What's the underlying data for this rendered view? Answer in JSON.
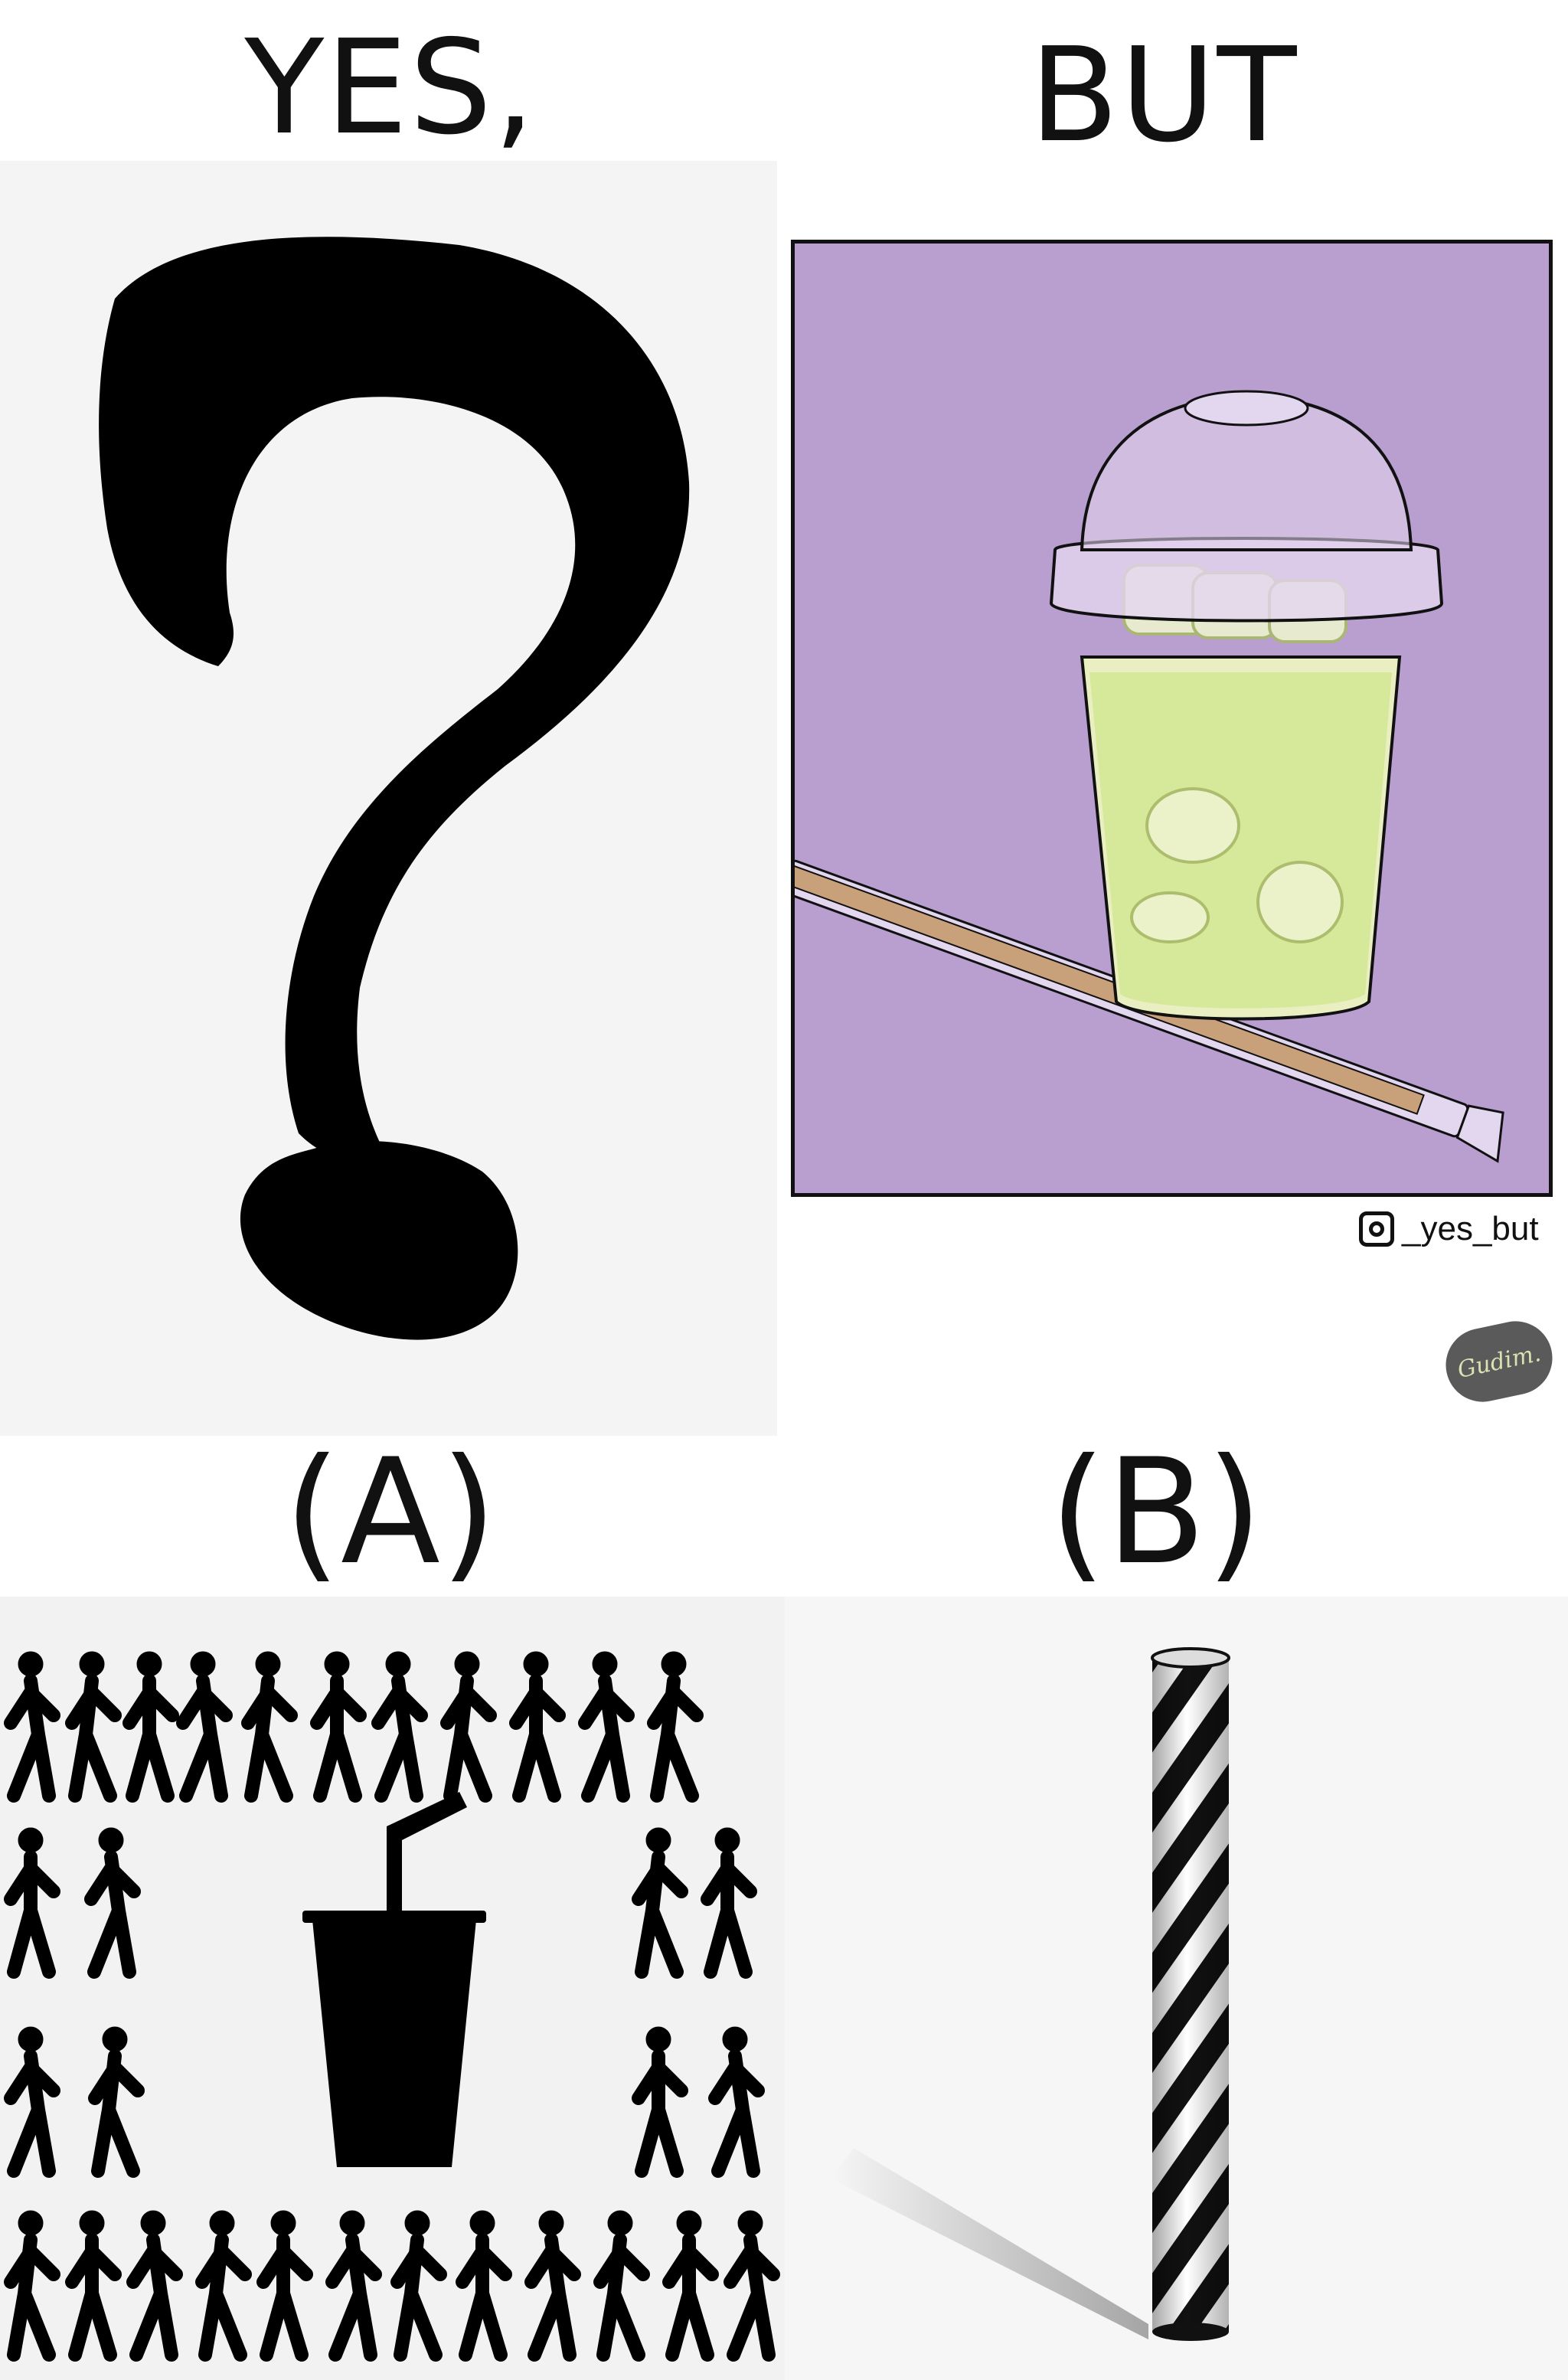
{
  "labels": {
    "yes": "YES,",
    "but": "BUT",
    "option_a": "(A)",
    "option_b": "(B)"
  },
  "credit": {
    "handle": "_yes_but",
    "icon": "instagram-icon"
  },
  "stamp": {
    "text": "Gudim."
  },
  "colors": {
    "panel_purple": "#b99fcf",
    "drink_green": "#d6e89a",
    "straw_brown": "#c8a07a",
    "ink": "#000000",
    "background_gray": "#f4f4f4"
  }
}
